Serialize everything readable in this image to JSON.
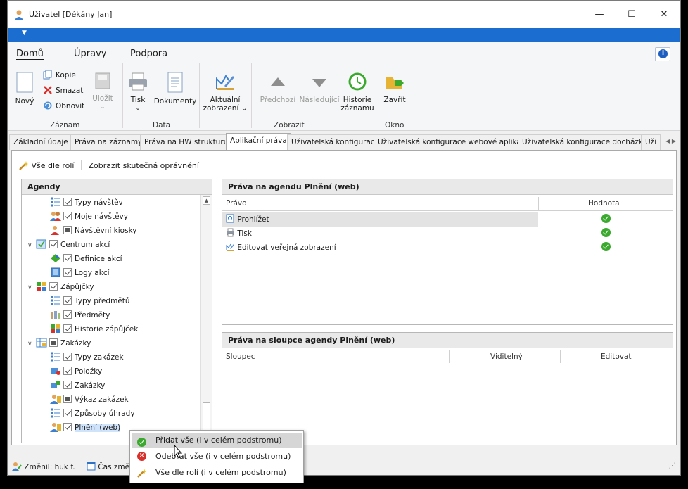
{
  "window": {
    "title": "Uživatel [Dékány Jan]",
    "minimize": "—",
    "maximize": "☐",
    "close": "✕"
  },
  "ribbon": {
    "tabs": [
      "Domů",
      "Úpravy",
      "Podpora"
    ],
    "help_icon": "info-icon",
    "buttons": {
      "new": "Nový",
      "copy": "Kopie",
      "delete": "Smazat",
      "refresh": "Obnovit",
      "save": "Uložit",
      "print": "Tisk",
      "documents": "Dokumenty",
      "current_view_1": "Aktuální",
      "current_view_2": "zobrazení",
      "previous": "Předchozí",
      "next": "Následující",
      "history_1": "Historie",
      "history_2": "záznamu",
      "close": "Zavřít"
    },
    "groups": {
      "record": "Záznam",
      "data": "Data",
      "view": "Zobrazit",
      "window": "Okno"
    }
  },
  "tabs": [
    "Základní údaje",
    "Práva na záznamy",
    "Práva na HW strukturu",
    "Aplikační práva",
    "Uživatelská konfigurace",
    "Uživatelská konfigurace webové aplikace",
    "Uživatelská konfigurace docházky",
    "Uži"
  ],
  "active_tab": "Aplikační práva",
  "toolbar": {
    "all_by_roles": "Vše dle rolí",
    "show_actual": "Zobrazit skutečná oprávnění"
  },
  "agendas": {
    "header": "Agendy",
    "items": [
      {
        "label": "Typy návštěv",
        "state": "checked",
        "level": 1
      },
      {
        "label": "Moje návštěvy",
        "state": "checked",
        "level": 1
      },
      {
        "label": "Návštěvní kiosky",
        "state": "partial",
        "level": 1
      },
      {
        "label": "Centrum akcí",
        "state": "checked",
        "level": 0,
        "expanded": true
      },
      {
        "label": "Definice akcí",
        "state": "checked",
        "level": 1
      },
      {
        "label": "Logy akcí",
        "state": "checked",
        "level": 1
      },
      {
        "label": "Zápůjčky",
        "state": "checked",
        "level": 0,
        "expanded": true
      },
      {
        "label": "Typy předmětů",
        "state": "checked",
        "level": 1
      },
      {
        "label": "Předměty",
        "state": "checked",
        "level": 1
      },
      {
        "label": "Historie zápůjček",
        "state": "checked",
        "level": 1
      },
      {
        "label": "Zakázky",
        "state": "partial",
        "level": 0,
        "expanded": true
      },
      {
        "label": "Typy zakázek",
        "state": "checked",
        "level": 1
      },
      {
        "label": "Položky",
        "state": "checked",
        "level": 1
      },
      {
        "label": "Zakázky",
        "state": "checked",
        "level": 1
      },
      {
        "label": "Výkaz zakázek",
        "state": "partial",
        "level": 1
      },
      {
        "label": "Způsoby úhrady",
        "state": "checked",
        "level": 1
      },
      {
        "label": "Plnění (web)",
        "state": "checked",
        "level": 1,
        "selected": true
      }
    ]
  },
  "rights_panel": {
    "title": "Práva na agendu Plnění (web)",
    "col_right": "Právo",
    "col_value": "Hodnota",
    "rows": [
      {
        "label": "Prohlížet",
        "value": "ok"
      },
      {
        "label": "Tisk",
        "value": "ok"
      },
      {
        "label": "Editovat veřejná zobrazení",
        "value": "ok"
      }
    ]
  },
  "columns_panel": {
    "title": "Práva na sloupce agendy Plnění (web)",
    "col_column": "Sloupec",
    "col_visible": "Viditelný",
    "col_edit": "Editovat"
  },
  "statusbar": {
    "changed": "Změnil: huk f.",
    "time": "Čas změ"
  },
  "context_menu": {
    "items": [
      "Přidat vše (i v celém podstromu)",
      "Odebrat vše (i v celém podstromu)",
      "Vše dle rolí (i v celém podstromu)"
    ]
  },
  "colors": {
    "accent": "#1c6dd0",
    "ok": "#3aa92e",
    "error": "#d9302c"
  }
}
